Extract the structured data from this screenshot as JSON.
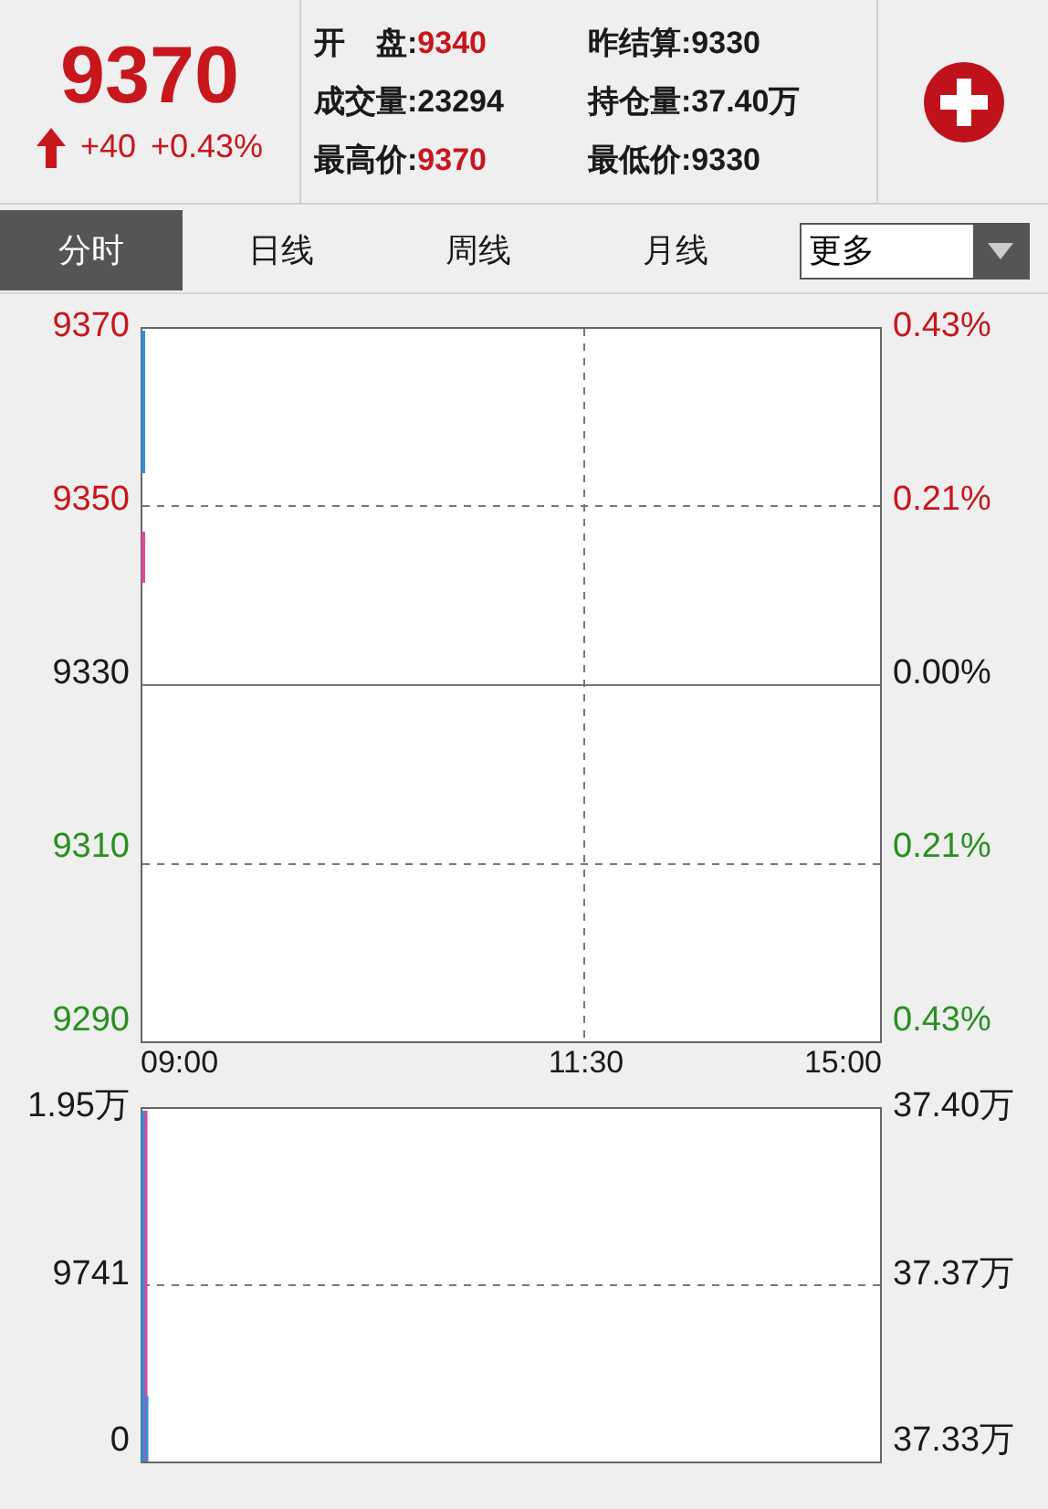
{
  "quote": {
    "price": "9370",
    "rising": true,
    "change": "+40",
    "change_pct": "+0.43%"
  },
  "stats": [
    {
      "label": "开　盘:",
      "value": "9340",
      "color": "#c8161d"
    },
    {
      "label": "昨结算:",
      "value": "9330",
      "color": "#1a1a1a"
    },
    {
      "label": "成交量:",
      "value": "23294",
      "color": "#1a1a1a"
    },
    {
      "label": "持仓量:",
      "value": "37.40万",
      "color": "#1a1a1a"
    },
    {
      "label": "最高价:",
      "value": "9370",
      "color": "#c8161d"
    },
    {
      "label": "最低价:",
      "value": "9330",
      "color": "#1a1a1a"
    }
  ],
  "tabs": [
    {
      "label": "分时",
      "selected": true
    },
    {
      "label": "日线",
      "selected": false
    },
    {
      "label": "周线",
      "selected": false
    },
    {
      "label": "月线",
      "selected": false
    }
  ],
  "dropdown": {
    "value": "更多"
  },
  "price_chart": {
    "left_labels": [
      {
        "text": "9370",
        "color": "#c8161d"
      },
      {
        "text": "9350",
        "color": "#c8161d"
      },
      {
        "text": "9330",
        "color": "#1a1a1a"
      },
      {
        "text": "9310",
        "color": "#2a8f1f"
      },
      {
        "text": "9290",
        "color": "#2a8f1f"
      }
    ],
    "right_labels": [
      {
        "text": "0.43%",
        "color": "#c8161d"
      },
      {
        "text": "0.21%",
        "color": "#c8161d"
      },
      {
        "text": "0.00%",
        "color": "#1a1a1a"
      },
      {
        "text": "0.21%",
        "color": "#2a8f1f"
      },
      {
        "text": "0.43%",
        "color": "#2a8f1f"
      }
    ],
    "time_labels": [
      "09:00",
      "11:30",
      "15:00"
    ]
  },
  "volume_chart": {
    "left_labels": [
      "1.95万",
      "9741",
      "0"
    ],
    "right_labels": [
      "37.40万",
      "37.37万",
      "37.33万"
    ]
  }
}
